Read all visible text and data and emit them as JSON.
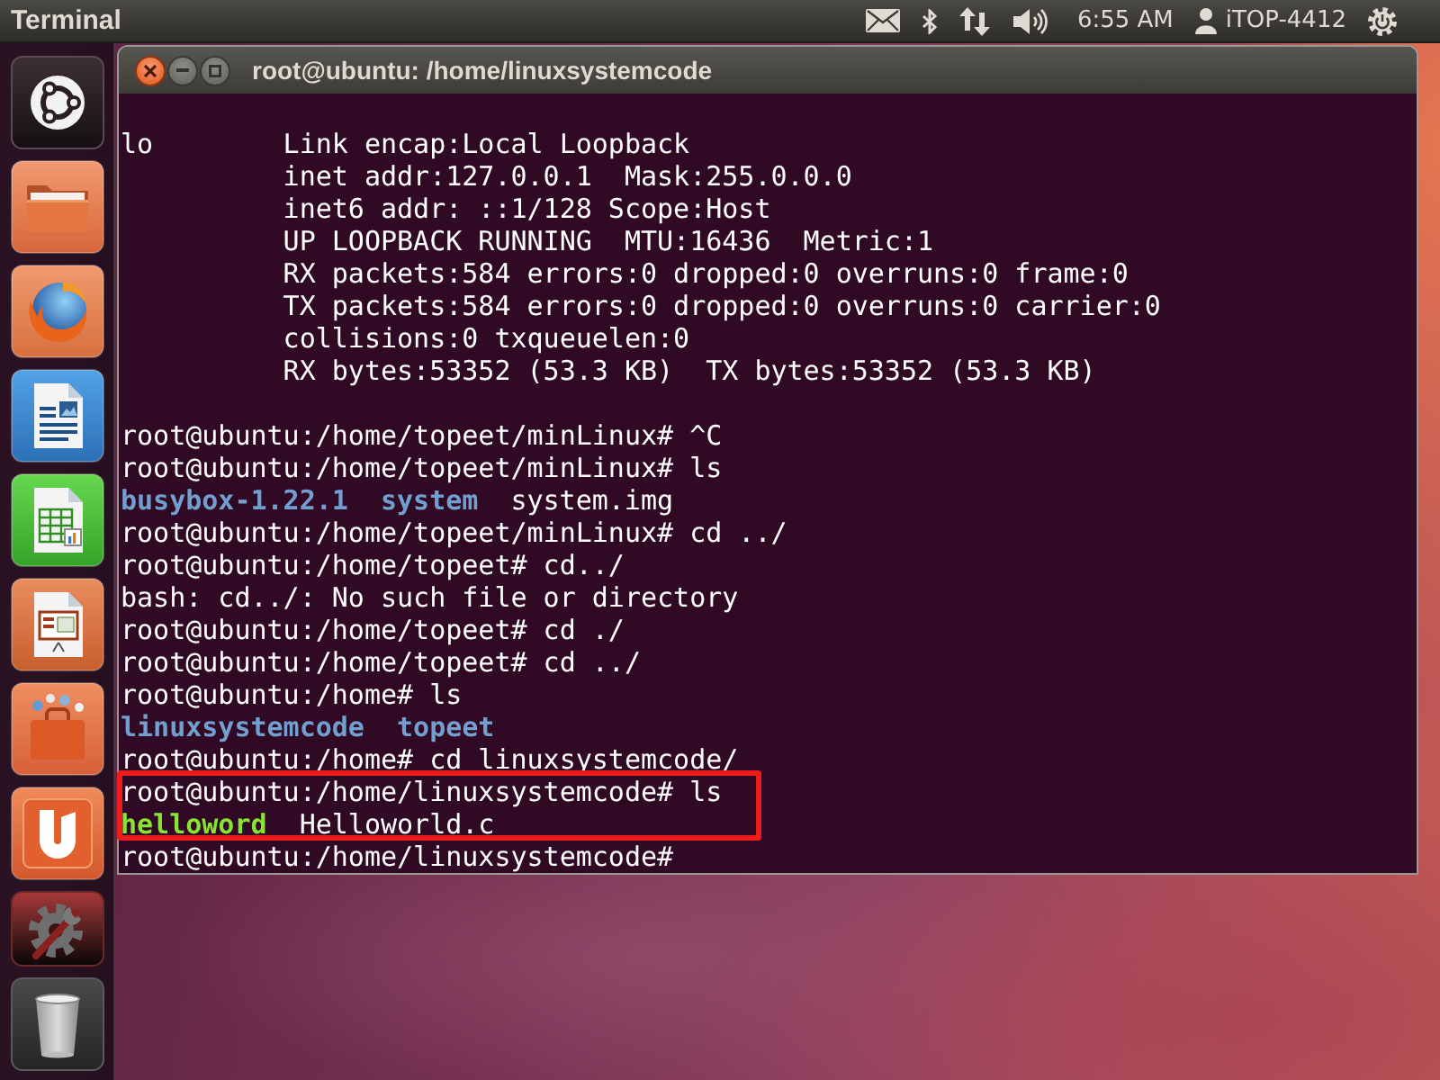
{
  "panel": {
    "app_title": "Terminal",
    "clock": "6:55 AM",
    "user": "iTOP-4412"
  },
  "launcher": {
    "items": [
      {
        "kind": "dash"
      },
      {
        "kind": "files"
      },
      {
        "kind": "browser"
      },
      {
        "kind": "writer"
      },
      {
        "kind": "calc"
      },
      {
        "kind": "impress"
      },
      {
        "kind": "software"
      },
      {
        "kind": "cloud"
      },
      {
        "kind": "settings"
      },
      {
        "kind": "trash"
      }
    ]
  },
  "terminal": {
    "title": "root@ubuntu: /home/linuxsystemcode",
    "lines": [
      {
        "kind": "blank",
        "highlighted": false
      },
      {
        "kind": "detail",
        "label": "lo",
        "text": "Link encap:Local Loopback",
        "highlighted": false
      },
      {
        "kind": "detail",
        "text": "inet addr:127.0.0.1  Mask:255.0.0.0",
        "highlighted": false
      },
      {
        "kind": "detail",
        "text": "inet6 addr: ::1/128 Scope:Host",
        "highlighted": false
      },
      {
        "kind": "detail",
        "text": "UP LOOPBACK RUNNING  MTU:16436  Metric:1",
        "highlighted": false
      },
      {
        "kind": "detail",
        "text": "RX packets:584 errors:0 dropped:0 overruns:0 frame:0",
        "highlighted": false
      },
      {
        "kind": "detail",
        "text": "TX packets:584 errors:0 dropped:0 overruns:0 carrier:0",
        "highlighted": false
      },
      {
        "kind": "detail",
        "text": "collisions:0 txqueuelen:0",
        "highlighted": false
      },
      {
        "kind": "detail",
        "text": "RX bytes:53352 (53.3 KB)  TX bytes:53352 (53.3 KB)",
        "highlighted": false
      },
      {
        "kind": "blank",
        "highlighted": false
      },
      {
        "kind": "prompt",
        "text": "root@ubuntu:/home/topeet/minLinux# ^C",
        "highlighted": false
      },
      {
        "kind": "prompt",
        "text": "root@ubuntu:/home/topeet/minLinux# ls",
        "highlighted": false
      },
      {
        "kind": "listing",
        "parts": [
          {
            "text": "busybox-1.22.1",
            "kind": "directory"
          },
          {
            "text": "system",
            "kind": "directory"
          },
          {
            "text": "system.img",
            "kind": "file"
          }
        ],
        "highlighted": false
      },
      {
        "kind": "prompt",
        "text": "root@ubuntu:/home/topeet/minLinux# cd ../",
        "highlighted": false
      },
      {
        "kind": "prompt",
        "text": "root@ubuntu:/home/topeet# cd../",
        "highlighted": false
      },
      {
        "kind": "output",
        "text": "bash: cd../: No such file or directory",
        "highlighted": false
      },
      {
        "kind": "prompt",
        "text": "root@ubuntu:/home/topeet# cd ./",
        "highlighted": false
      },
      {
        "kind": "prompt",
        "text": "root@ubuntu:/home/topeet# cd ../",
        "highlighted": false
      },
      {
        "kind": "prompt",
        "text": "root@ubuntu:/home# ls",
        "highlighted": false
      },
      {
        "kind": "listing",
        "parts": [
          {
            "text": "linuxsystemcode",
            "kind": "directory"
          },
          {
            "text": "topeet",
            "kind": "directory"
          }
        ],
        "highlighted": false
      },
      {
        "kind": "prompt",
        "text": "root@ubuntu:/home# cd linuxsystemcode/",
        "highlighted": false
      },
      {
        "kind": "prompt",
        "text": "root@ubuntu:/home/linuxsystemcode# ls",
        "highlighted": true
      },
      {
        "kind": "listing",
        "parts": [
          {
            "text": "helloword",
            "kind": "executable"
          },
          {
            "text": "Helloworld.c",
            "kind": "file"
          }
        ],
        "highlighted": true
      },
      {
        "kind": "prompt",
        "text": "root@ubuntu:/home/linuxsystemcode#",
        "highlighted": false
      }
    ]
  }
}
